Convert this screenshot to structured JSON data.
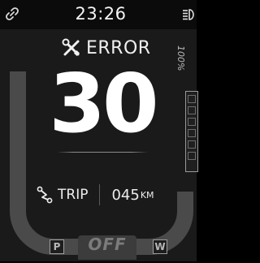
{
  "status_bar": {
    "time": "23:26",
    "link_icon": "link-icon",
    "light_icon": "headlight-icon"
  },
  "status": {
    "label": "ERROR",
    "icon": "wrench-screwdriver-icon"
  },
  "speed": {
    "value": "30"
  },
  "battery": {
    "label": "100%",
    "level": 1.0
  },
  "trip": {
    "icon": "route-icon",
    "label": "TRIP",
    "value": "045",
    "unit": "KM"
  },
  "assist": {
    "left_mode": "P",
    "state": "OFF",
    "right_mode": "W"
  },
  "colors": {
    "background": "#1a1a1a",
    "text": "#f2f2f2",
    "track": "#4a4a4a"
  }
}
